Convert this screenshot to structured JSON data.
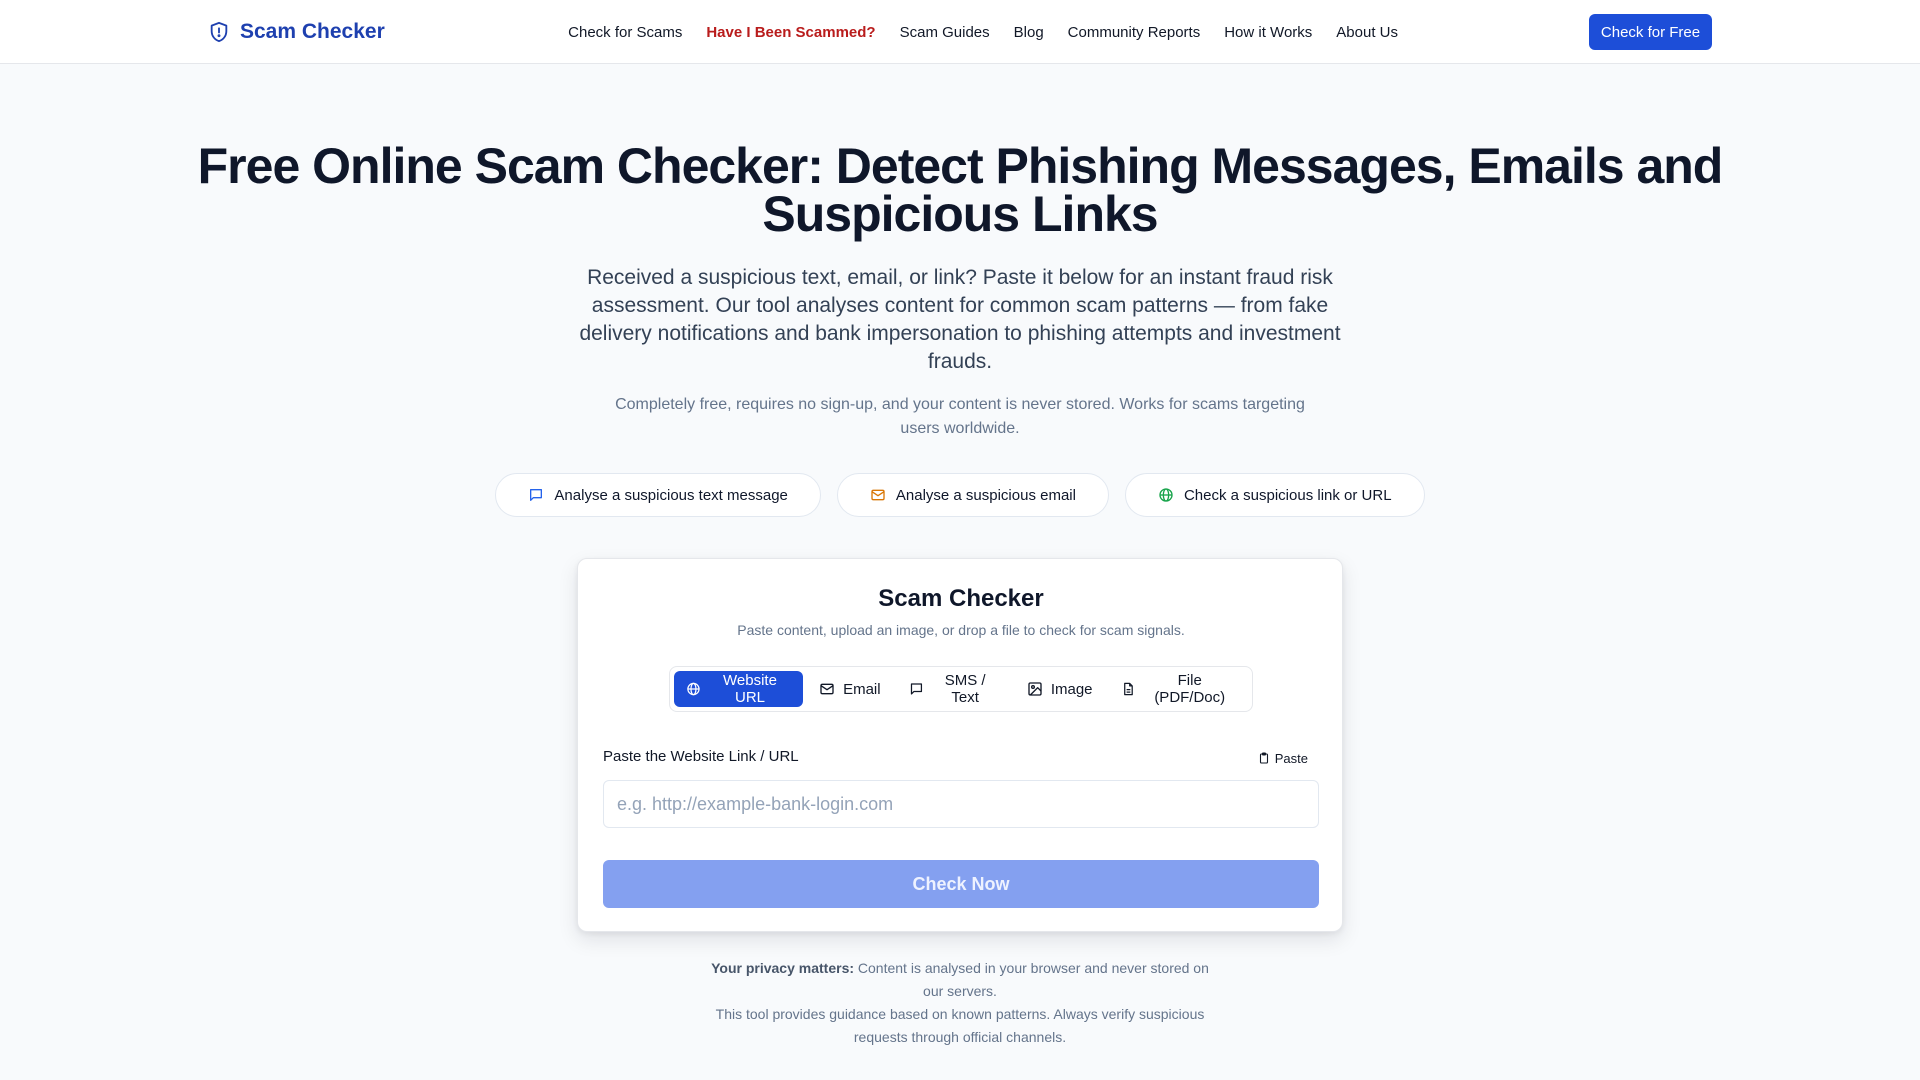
{
  "header": {
    "brand": "Scam Checker",
    "nav": [
      {
        "label": "Check for Scams"
      },
      {
        "label": "Have I Been Scammed?"
      },
      {
        "label": "Scam Guides"
      },
      {
        "label": "Blog"
      },
      {
        "label": "Community Reports"
      },
      {
        "label": "How it Works"
      },
      {
        "label": "About Us"
      }
    ],
    "cta_label": "Check for Free"
  },
  "hero": {
    "title": "Free Online Scam Checker: Detect Phishing Messages, Emails and Suspicious Links",
    "lead": "Received a suspicious text, email, or link? Paste it below for an instant fraud risk assessment. Our tool analyses content for common scam patterns — from fake delivery notifications and bank impersonation to phishing attempts and investment frauds.",
    "sub": "Completely free, requires no sign-up, and your content is never stored. Works for scams targeting users worldwide."
  },
  "quick_actions": [
    {
      "label": "Analyse a suspicious text message",
      "icon": "message-icon",
      "color": "#2563eb"
    },
    {
      "label": "Analyse a suspicious email",
      "icon": "mail-icon",
      "color": "#d97706"
    },
    {
      "label": "Check a suspicious link or URL",
      "icon": "globe-icon",
      "color": "#16a34a"
    }
  ],
  "checker": {
    "title": "Scam Checker",
    "subtitle": "Paste content, upload an image, or drop a file to check for scam signals.",
    "tabs": [
      {
        "label": "Website URL",
        "icon": "globe-icon",
        "active": true
      },
      {
        "label": "Email",
        "icon": "mail-icon",
        "active": false
      },
      {
        "label": "SMS / Text",
        "icon": "message-icon",
        "active": false
      },
      {
        "label": "Image",
        "icon": "image-icon",
        "active": false
      },
      {
        "label": "File (PDF/Doc)",
        "icon": "file-icon",
        "active": false
      }
    ],
    "field_label": "Paste the Website Link / URL",
    "paste_label": "Paste",
    "input_value": "",
    "input_placeholder": "e.g. http://example-bank-login.com",
    "submit_label": "Check Now"
  },
  "footer_notes": {
    "privacy_strong": "Your privacy matters:",
    "privacy_text": "Content is analysed in your browser and never stored on our servers.",
    "disclaimer": "This tool provides guidance based on known patterns. Always verify suspicious requests through official channels."
  },
  "colors": {
    "brand": "#1e40af",
    "primary": "#1d4ed8",
    "alert_link": "#b91c1c",
    "disabled_button": "#84a0f0"
  }
}
